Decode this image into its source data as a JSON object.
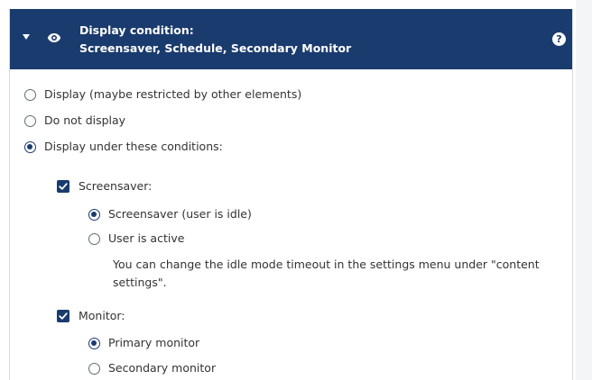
{
  "header": {
    "title_line1": "Display condition:",
    "title_line2": "Screensaver, Schedule, Secondary Monitor",
    "help_label": "?"
  },
  "display_options": [
    {
      "label": "Display (maybe restricted by other elements)",
      "selected": false
    },
    {
      "label": "Do not display",
      "selected": false
    },
    {
      "label": "Display under these conditions:",
      "selected": true
    }
  ],
  "screensaver": {
    "label": "Screensaver:",
    "checked": true,
    "options": [
      {
        "label": "Screensaver (user is idle)",
        "selected": true
      },
      {
        "label": "User is active",
        "selected": false
      }
    ],
    "hint": "You can change the idle mode timeout in the settings menu under \"content settings\"."
  },
  "monitor": {
    "label": "Monitor:",
    "checked": true,
    "options": [
      {
        "label": "Primary monitor",
        "selected": true
      },
      {
        "label": "Secondary monitor",
        "selected": false
      }
    ]
  },
  "colors": {
    "header_bg": "#1a3b6e",
    "accent": "#1a3b6e",
    "text": "#333333"
  },
  "icons": {
    "caret": "caret-down-icon",
    "eye": "eye-icon",
    "help": "help-icon"
  }
}
